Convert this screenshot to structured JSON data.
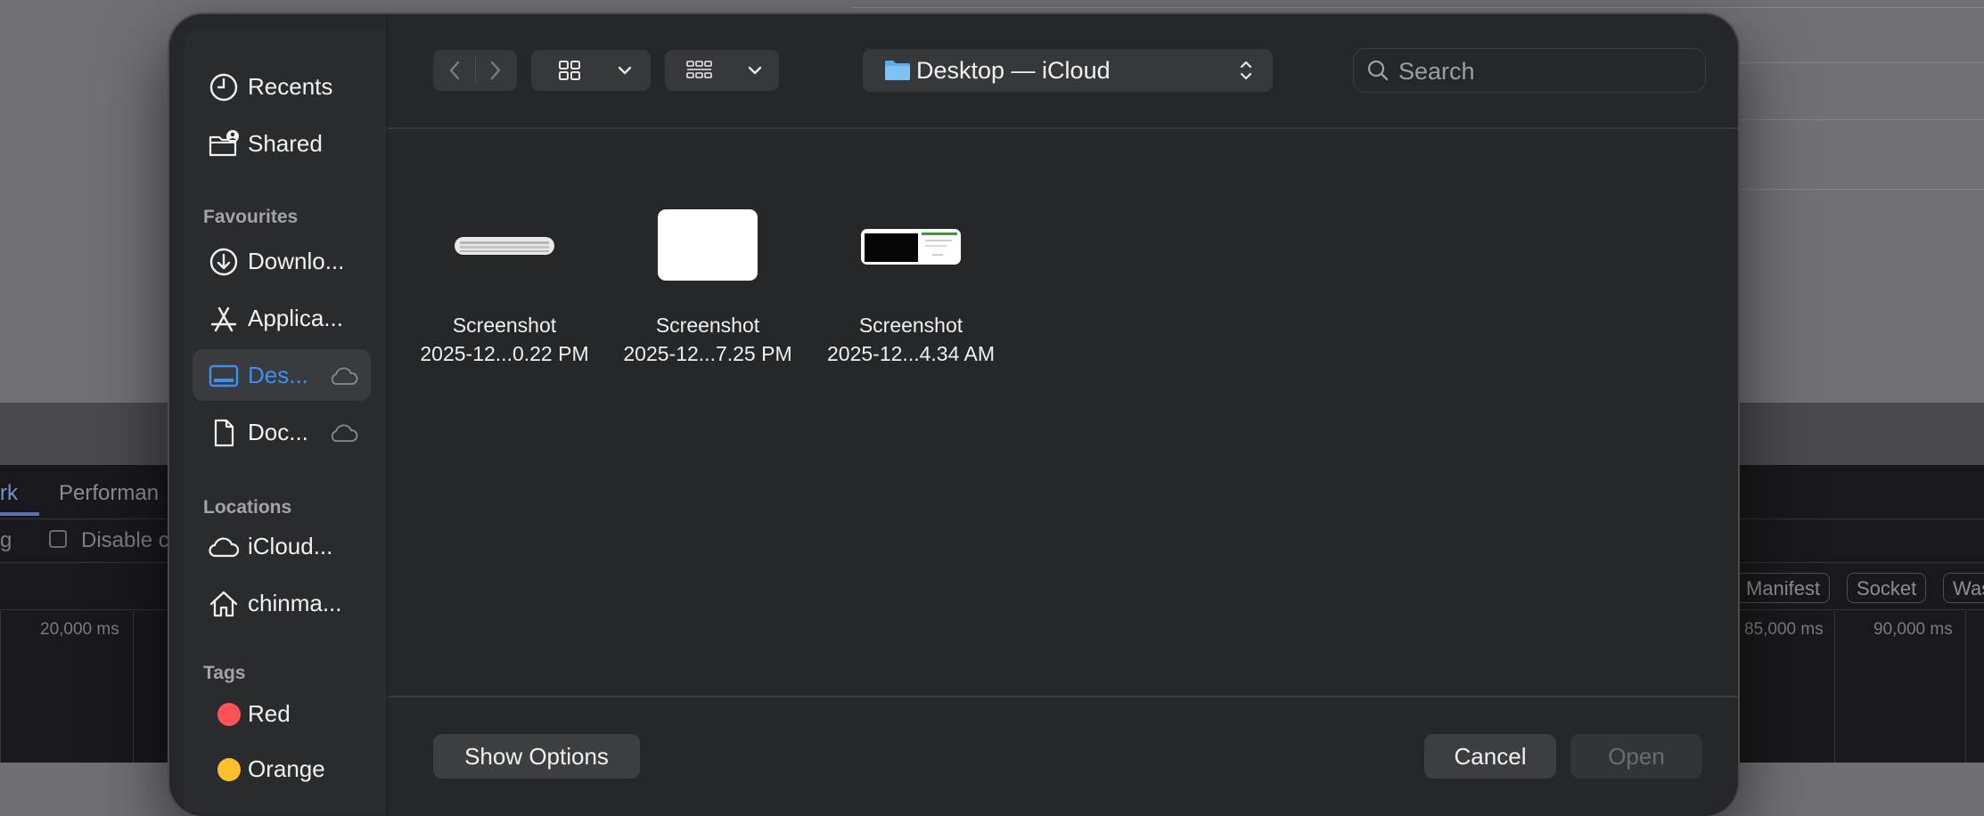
{
  "background": {
    "devtools_tabs": [
      "rk",
      "Performan"
    ],
    "row2_left": "g",
    "row2_checkbox_label": "Disable c",
    "filter_chips": [
      "Manifest",
      "Socket",
      "Was"
    ],
    "timeline_ticks": [
      "20,000 ms",
      "85,000 ms",
      "90,000 ms"
    ]
  },
  "sidebar": {
    "items_top": [
      {
        "label": "Recents",
        "icon": "clock-icon"
      },
      {
        "label": "Shared",
        "icon": "shared-folder-icon"
      }
    ],
    "favourites_heading": "Favourites",
    "favourites": [
      {
        "label": "Downlo...",
        "icon": "download-icon"
      },
      {
        "label": "Applica...",
        "icon": "applications-icon"
      },
      {
        "label": "Des...",
        "icon": "desktop-icon",
        "selected": true,
        "cloud": true
      },
      {
        "label": "Doc...",
        "icon": "document-icon",
        "cloud": true
      }
    ],
    "locations_heading": "Locations",
    "locations": [
      {
        "label": "iCloud...",
        "icon": "cloud-icon"
      },
      {
        "label": "chinma...",
        "icon": "home-icon"
      }
    ],
    "tags_heading": "Tags",
    "tags": [
      {
        "label": "Red",
        "color": "#ff5257"
      },
      {
        "label": "Orange",
        "color": "#ffbf2f"
      }
    ],
    "accent_color": "#3b8ff0"
  },
  "toolbar": {
    "back_icon": "chevron-left-icon",
    "forward_icon": "chevron-right-icon",
    "view_icon": "grid-icon",
    "group_icon": "group-grid-icon",
    "path_label": "Desktop — iCloud",
    "search_placeholder": "Search"
  },
  "files": [
    {
      "line1": "Screenshot",
      "line2": "2025-12...0.22 PM"
    },
    {
      "line1": "Screenshot",
      "line2": "2025-12...7.25 PM"
    },
    {
      "line1": "Screenshot",
      "line2": "2025-12...4.34 AM"
    }
  ],
  "buttons": {
    "show_options": "Show Options",
    "cancel": "Cancel",
    "open": "Open"
  }
}
